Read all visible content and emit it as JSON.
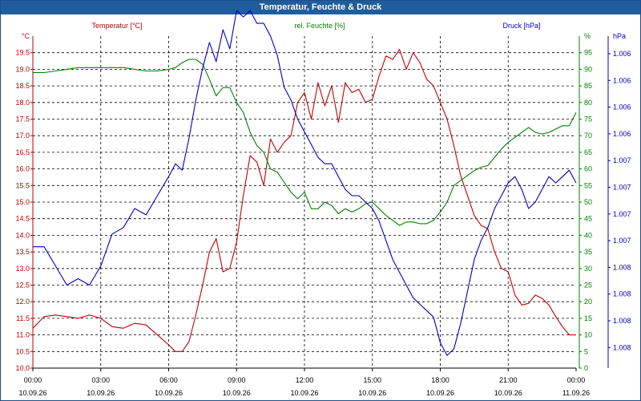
{
  "window": {
    "title": "Temperatur, Feuchte & Druck"
  },
  "chart_data": {
    "type": "line",
    "title": "Temperatur, Feuchte & Druck",
    "colors": {
      "temperature": "#c00000",
      "humidity": "#008000",
      "pressure": "#0000c0",
      "titlebar": "#1f5d9c",
      "grid": "#000000"
    },
    "x_ticks": [
      {
        "time": "00:00",
        "date": "10.09.26",
        "hour": 0
      },
      {
        "time": "03:00",
        "date": "10.09.26",
        "hour": 3
      },
      {
        "time": "06:00",
        "date": "10.09.26",
        "hour": 6
      },
      {
        "time": "09:00",
        "date": "10.09.26",
        "hour": 9
      },
      {
        "time": "12:00",
        "date": "10.09.26",
        "hour": 12
      },
      {
        "time": "15:00",
        "date": "10.09.26",
        "hour": 15
      },
      {
        "time": "18:00",
        "date": "10.09.26",
        "hour": 18
      },
      {
        "time": "21:00",
        "date": "10.09.26",
        "hour": 21
      },
      {
        "time": "00:00",
        "date": "11.09.26",
        "hour": 24
      }
    ],
    "axes": {
      "temperature": {
        "label": "Temperatur [°C]",
        "unit": "°C",
        "ylim": [
          10.0,
          20.0
        ],
        "ticks": [
          "10.0",
          "10.5",
          "11.0",
          "11.5",
          "12.0",
          "12.5",
          "13.0",
          "13.5",
          "14.0",
          "14.5",
          "15.0",
          "15.5",
          "16.0",
          "16.5",
          "17.0",
          "17.5",
          "18.0",
          "18.5",
          "19.0",
          "19.5"
        ]
      },
      "humidity": {
        "label": "rel. Feuchte [%]",
        "unit": "%",
        "ylim": [
          0,
          100
        ],
        "ticks": [
          "0",
          "5",
          "10",
          "15",
          "20",
          "25",
          "30",
          "35",
          "40",
          "45",
          "50",
          "55",
          "60",
          "65",
          "70",
          "75",
          "80",
          "85",
          "90",
          "95"
        ]
      },
      "pressure": {
        "label": "Druck [hPa]",
        "unit": "hPa",
        "ylim": [
          1005.6,
          1008.2
        ],
        "ticks": [
          "1.006",
          "1.006",
          "1.006",
          "1.006",
          "1.007",
          "1.007",
          "1.007",
          "1.007",
          "1.008",
          "1.008",
          "1.008",
          "1.008"
        ]
      }
    },
    "series": [
      {
        "name": "Temperatur [°C]",
        "color": "#c00000",
        "axis": "temperature",
        "x": [
          0,
          0.5,
          1,
          1.5,
          2,
          2.5,
          3,
          3.5,
          4,
          4.5,
          5,
          5.5,
          6,
          6.3,
          6.6,
          6.9,
          7.2,
          7.5,
          7.8,
          8.1,
          8.4,
          8.7,
          9,
          9.3,
          9.6,
          9.9,
          10.2,
          10.5,
          10.8,
          11.1,
          11.4,
          11.7,
          12,
          12.3,
          12.6,
          12.9,
          13.2,
          13.5,
          13.8,
          14.1,
          14.4,
          14.7,
          15,
          15.3,
          15.6,
          15.9,
          16.2,
          16.5,
          16.8,
          17.1,
          17.4,
          17.7,
          18,
          18.3,
          18.6,
          18.9,
          19.2,
          19.5,
          19.8,
          20.1,
          20.4,
          20.7,
          21,
          21.3,
          21.6,
          21.9,
          22.2,
          22.5,
          22.8,
          23.1,
          23.4,
          23.7,
          24
        ],
        "y": [
          11.2,
          11.55,
          11.6,
          11.55,
          11.5,
          11.6,
          11.5,
          11.25,
          11.2,
          11.35,
          11.3,
          11.0,
          10.7,
          10.5,
          10.5,
          10.8,
          11.6,
          12.5,
          13.5,
          13.9,
          12.9,
          13.0,
          13.8,
          15.2,
          16.4,
          16.2,
          15.5,
          16.9,
          16.5,
          16.8,
          17.0,
          18.0,
          18.3,
          17.5,
          18.6,
          17.9,
          18.5,
          17.4,
          18.6,
          18.3,
          18.4,
          18.0,
          18.1,
          18.8,
          19.4,
          19.3,
          19.6,
          19.0,
          19.5,
          19.2,
          18.7,
          18.5,
          18.0,
          17.5,
          16.7,
          15.8,
          15.2,
          14.6,
          14.3,
          14.2,
          13.5,
          13.0,
          12.9,
          12.2,
          11.9,
          11.95,
          12.2,
          12.1,
          11.9,
          11.55,
          11.25,
          11.0,
          11.0
        ]
      },
      {
        "name": "rel. Feuchte [%]",
        "color": "#008000",
        "axis": "humidity",
        "x": [
          0,
          0.5,
          1,
          1.5,
          2,
          2.5,
          3,
          3.5,
          4,
          4.5,
          5,
          5.5,
          6,
          6.3,
          6.6,
          6.9,
          7.2,
          7.5,
          7.8,
          8.1,
          8.4,
          8.7,
          9,
          9.3,
          9.6,
          9.9,
          10.2,
          10.5,
          10.8,
          11.1,
          11.4,
          11.7,
          12,
          12.3,
          12.6,
          12.9,
          13.2,
          13.5,
          13.8,
          14.1,
          14.4,
          14.7,
          15,
          15.3,
          15.6,
          15.9,
          16.2,
          16.5,
          16.8,
          17.1,
          17.4,
          17.7,
          18,
          18.3,
          18.6,
          18.9,
          19.2,
          19.5,
          19.8,
          20.1,
          20.4,
          20.7,
          21,
          21.3,
          21.6,
          21.9,
          22.2,
          22.5,
          22.8,
          23.1,
          23.4,
          23.7,
          24
        ],
        "y": [
          89,
          89,
          89.5,
          90,
          90.5,
          90.5,
          90.5,
          90.5,
          90.5,
          90,
          89.5,
          89.5,
          90,
          90.5,
          92,
          93,
          93,
          91.5,
          87,
          82,
          84.5,
          84.5,
          80,
          77,
          71,
          67,
          65,
          60,
          59,
          56,
          53,
          51,
          53,
          48,
          48,
          50,
          49,
          46.5,
          48,
          47,
          48,
          49.5,
          50,
          48,
          46,
          44.5,
          43,
          44,
          44,
          43.5,
          43.5,
          44.5,
          47,
          50,
          55,
          56.5,
          58,
          59.5,
          60.5,
          61,
          63.5,
          66,
          68,
          69.5,
          71,
          72.5,
          71,
          70.5,
          71,
          72,
          73,
          73,
          77
        ]
      },
      {
        "name": "Druck [hPa]",
        "color": "#0000c0",
        "axis": "pressure",
        "x": [
          0,
          0.5,
          1,
          1.5,
          2,
          2.5,
          3,
          3.5,
          4,
          4.5,
          5,
          5.5,
          6,
          6.3,
          6.6,
          6.9,
          7.2,
          7.5,
          7.8,
          8.1,
          8.4,
          8.7,
          9,
          9.3,
          9.6,
          9.9,
          10.2,
          10.5,
          10.8,
          11.1,
          11.4,
          11.7,
          12,
          12.3,
          12.6,
          12.9,
          13.2,
          13.5,
          13.8,
          14.1,
          14.4,
          14.7,
          15,
          15.3,
          15.6,
          15.9,
          16.2,
          16.5,
          16.8,
          17.1,
          17.4,
          17.7,
          18,
          18.3,
          18.6,
          18.9,
          19.2,
          19.5,
          19.8,
          20.1,
          20.4,
          20.7,
          21,
          21.3,
          21.6,
          21.9,
          22.2,
          22.5,
          22.8,
          23.1,
          23.4,
          23.7,
          24
        ],
        "y": [
          1006.55,
          1006.55,
          1006.4,
          1006.25,
          1006.3,
          1006.25,
          1006.4,
          1006.65,
          1006.7,
          1006.85,
          1006.8,
          1006.95,
          1007.1,
          1007.2,
          1007.15,
          1007.4,
          1007.7,
          1007.95,
          1008.15,
          1008.0,
          1008.25,
          1008.1,
          1008.4,
          1008.35,
          1008.4,
          1008.3,
          1008.3,
          1008.2,
          1008.05,
          1007.8,
          1007.7,
          1007.55,
          1007.45,
          1007.35,
          1007.25,
          1007.2,
          1007.2,
          1007.1,
          1007.0,
          1006.95,
          1006.95,
          1006.9,
          1006.85,
          1006.75,
          1006.6,
          1006.45,
          1006.35,
          1006.25,
          1006.15,
          1006.1,
          1006.05,
          1006.0,
          1005.8,
          1005.7,
          1005.75,
          1005.95,
          1006.2,
          1006.45,
          1006.6,
          1006.7,
          1006.85,
          1006.95,
          1007.05,
          1007.1,
          1007.0,
          1006.85,
          1006.9,
          1007.0,
          1007.1,
          1007.05,
          1007.1,
          1007.15,
          1007.05
        ]
      }
    ]
  }
}
